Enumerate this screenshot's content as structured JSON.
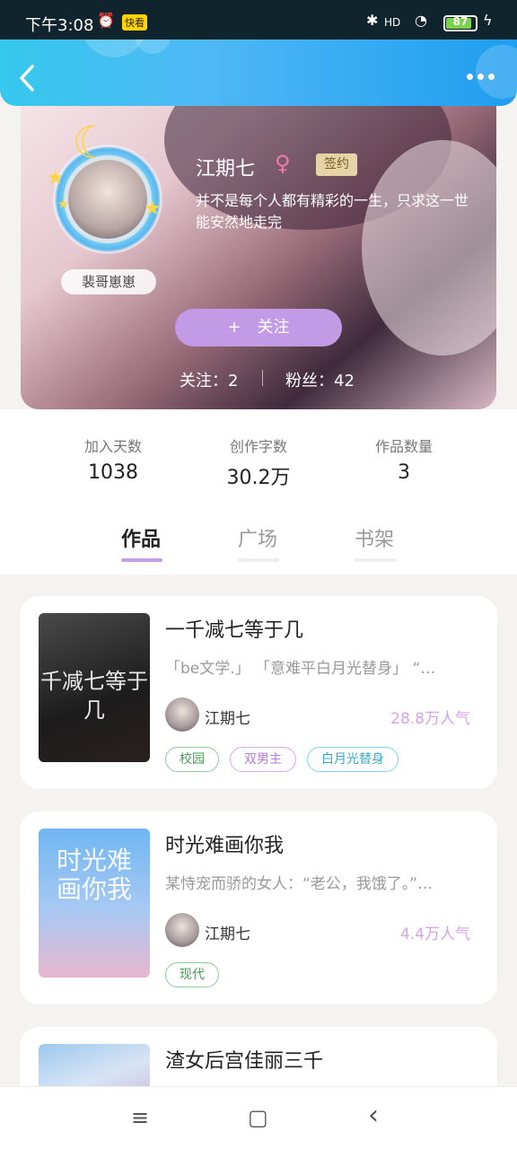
{
  "status": {
    "time": "下午3:08",
    "battery": "87",
    "battery_level": 0.87,
    "network": "HD"
  },
  "header": {
    "back_icon": "chevron-left-icon",
    "more_icon": "more-dots-icon"
  },
  "profile": {
    "nickname": "裴哥崽崽",
    "name": "江期七",
    "gender_symbol": "♀",
    "sign_badge": "签约",
    "bio": "并不是每个人都有精彩的一生，只求这一世能安然地走完",
    "follow_label": "关注",
    "follow_plus": "+",
    "following": "关注：2",
    "fans": "粉丝：42"
  },
  "stats": [
    {
      "label": "加入天数",
      "value": "1038"
    },
    {
      "label": "创作字数",
      "value": "30.2万"
    },
    {
      "label": "作品数量",
      "value": "3"
    }
  ],
  "tabs": [
    {
      "label": "作品",
      "active": true
    },
    {
      "label": "广场",
      "active": false
    },
    {
      "label": "书架",
      "active": false
    }
  ],
  "books": [
    {
      "title": "一千减七等于几",
      "cover_text": "千减七等于几",
      "desc": "「be文学.」 「意难平白月光替身」 “…",
      "author": "江期七",
      "popularity": "28.8万人气",
      "tags": [
        "校园",
        "双男主",
        "白月光替身"
      ]
    },
    {
      "title": "时光难画你我",
      "cover_text": "时光难画你我",
      "desc": "某恃宠而骄的女人：“老公，我饿了。”…",
      "author": "江期七",
      "popularity": "4.4万人气",
      "tags": [
        "现代"
      ]
    },
    {
      "title": "渣女后宫佳丽三千",
      "cover_text": "",
      "desc": "",
      "author": "",
      "popularity": "",
      "tags": []
    }
  ],
  "navbar": {
    "menu_icon": "≡",
    "home_icon": "▢",
    "back_icon": "‹"
  }
}
